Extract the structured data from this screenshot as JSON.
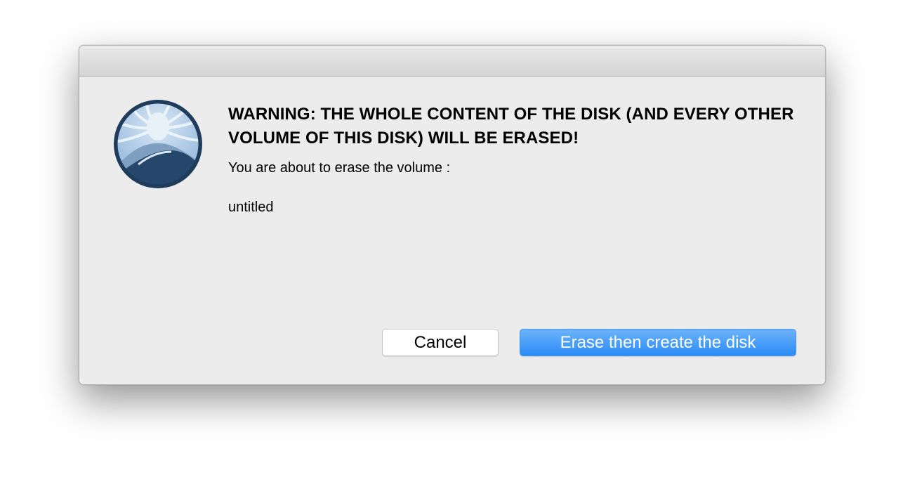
{
  "dialog": {
    "headline": "WARNING: THE WHOLE CONTENT OF THE DISK (AND EVERY OTHER VOLUME OF THIS DISK) WILL BE ERASED!",
    "message": "You are about to erase the volume :",
    "volume_name": "untitled",
    "icon": "disk-creator-lion-icon",
    "buttons": {
      "cancel_label": "Cancel",
      "confirm_label": "Erase then create the disk"
    }
  },
  "colors": {
    "dialog_background": "#ececec",
    "primary_button": "#3a93f8",
    "icon_dark_blue": "#1f3c5b",
    "icon_light_blue": "#a9c6e3"
  }
}
